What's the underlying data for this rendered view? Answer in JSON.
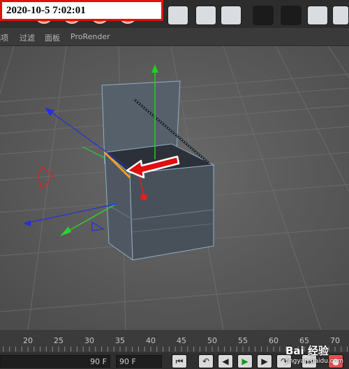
{
  "timestamp": "2020-10-5 7:02:01",
  "menu": {
    "items": [
      "选项",
      "过滤",
      "面板",
      "ProRender"
    ],
    "partial_first": "选项"
  },
  "timeline": {
    "ticks": [
      "20",
      "25",
      "30",
      "35",
      "40",
      "45",
      "50",
      "55",
      "60",
      "65",
      "70"
    ]
  },
  "bottom": {
    "field1": "90 F",
    "field2": "90 F"
  },
  "watermark": {
    "text": "Bai 经验",
    "url": "jingyan.baidu.com"
  },
  "colors": {
    "axis_x": "#e02020",
    "axis_y": "#20d020",
    "axis_z": "#2030e0",
    "selection": "#f0a020",
    "annotation_arrow": "#e01010"
  }
}
